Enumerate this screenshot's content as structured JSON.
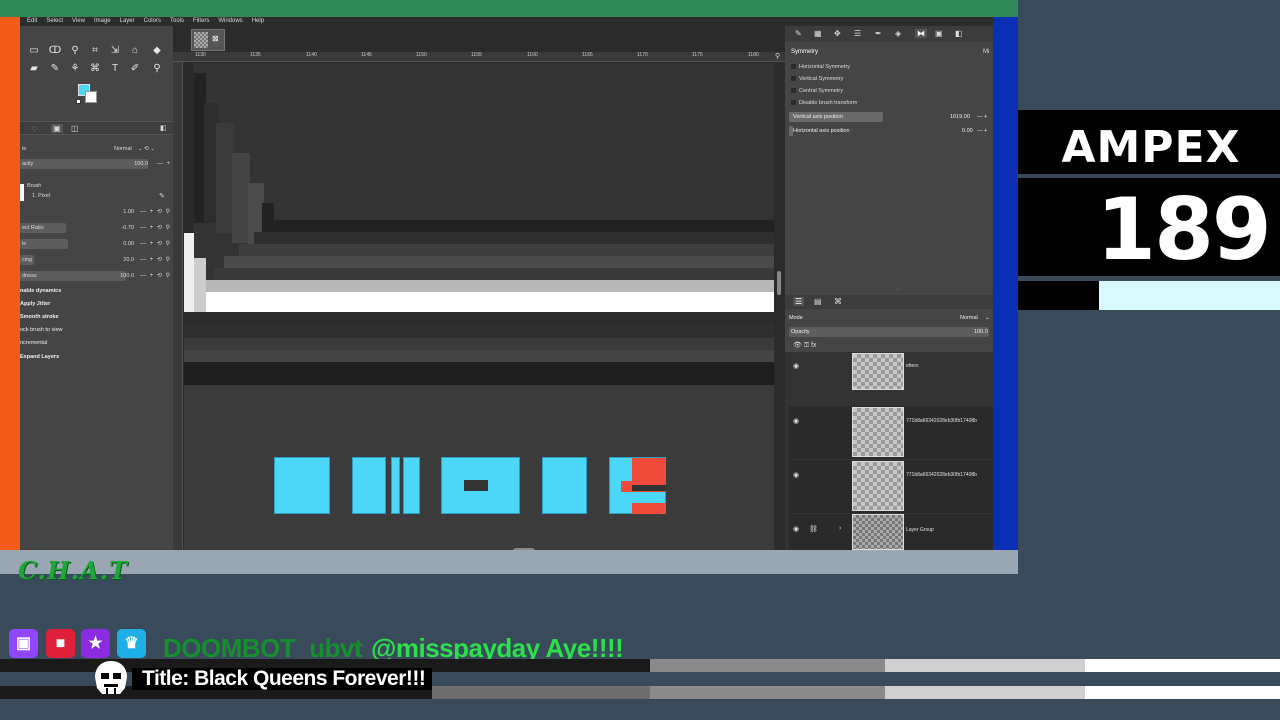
{
  "menubar": [
    "Edit",
    "Select",
    "View",
    "Image",
    "Layer",
    "Colors",
    "Tools",
    "Filters",
    "Windows",
    "Help"
  ],
  "tool_options": {
    "mode_label": "le",
    "mode_value": "Normal",
    "opacity_label": "acity",
    "opacity_value": "100.0",
    "brush_label": "Brush",
    "brush_name": "1. Pixel",
    "size_value": "1.00",
    "aspect_label": "ect Ratio",
    "aspect_value": "-0.70",
    "angle_label": "le",
    "angle_value": "0.00",
    "spacing_label": "cing",
    "spacing_value": "20.0",
    "hardness_label": "dness",
    "hardness_value": "100.0",
    "checks": [
      "nable dynamics",
      "Apply Jitter",
      "Smooth stroke",
      "ock brush to view",
      "ncremental",
      "Expand Layers"
    ]
  },
  "ruler": [
    "1130",
    "1135",
    "1140",
    "1145",
    "1150",
    "1155",
    "1160",
    "1165",
    "1170",
    "1175",
    "1180"
  ],
  "symmetry": {
    "title": "Symmetry",
    "tab_right": "Mi",
    "options": [
      "Horizontal Symmetry",
      "Vertical Symmetry",
      "Central Symmetry",
      "Disable brush transform"
    ],
    "vertical_axis_label": "Vertical axis position",
    "vertical_axis_value": "1019.00",
    "horizontal_axis_label": "Horizontal axis position",
    "horizontal_axis_value": "0.00"
  },
  "layers": {
    "mode_label": "Mode",
    "mode_value": "Normal",
    "opacity_label": "Opacity",
    "opacity_value": "100.0",
    "items": [
      {
        "name": "etters"
      },
      {
        "name": "771b8a66342028eb30fb17408b"
      },
      {
        "name": "771b8a66342028eb30fb17408b"
      },
      {
        "name": "Layer Group"
      }
    ]
  },
  "ampex": {
    "word": "AMPEX",
    "number": "189"
  },
  "chat": {
    "logo": "C.H.A.T",
    "username": "DOOMBOT_ubvt",
    "message": "@misspayday Aye!!!!"
  },
  "stream_title": "Title: Black Queens Forever!!!",
  "colors": {
    "accent_cyan": "#4cd6f7",
    "red": "#f04a3a",
    "orange": "#f25a18",
    "blue": "#0a2fb4",
    "green": "#2e8b57"
  }
}
